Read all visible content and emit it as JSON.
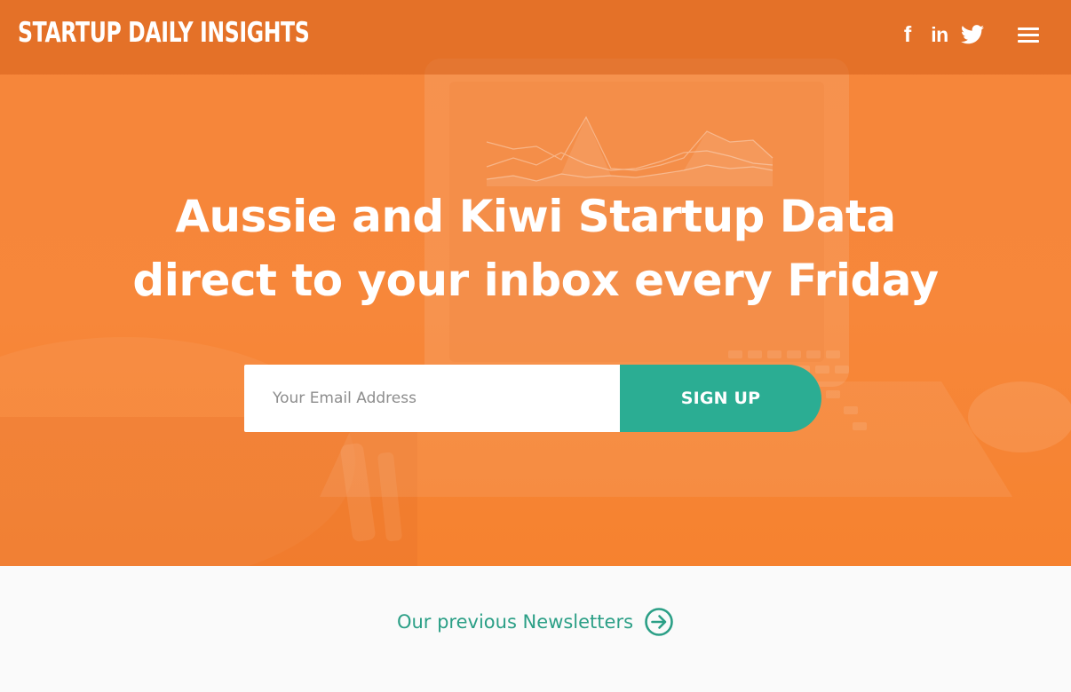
{
  "header": {
    "logo": "STARTUP DAILY INSIGHTS",
    "social": {
      "facebook_label": "f",
      "linkedin_label": "in",
      "twitter_icon": "twitter-icon"
    },
    "menu_icon": "hamburger-menu-icon"
  },
  "hero": {
    "headline_line1": "Aussie and Kiwi Startup Data",
    "headline_line2": "direct to your inbox every Friday",
    "email_placeholder": "Your Email Address",
    "signup_label": "SIGN UP"
  },
  "footer": {
    "previous_link_label": "Our previous Newsletters",
    "previous_link_icon": "circle-arrow-right-icon"
  },
  "colors": {
    "hero_orange": "#f7873a",
    "topbar_orange": "#d66019",
    "accent_green": "#2bad93",
    "link_green": "#2b9f86",
    "page_bg": "#fafafa"
  }
}
